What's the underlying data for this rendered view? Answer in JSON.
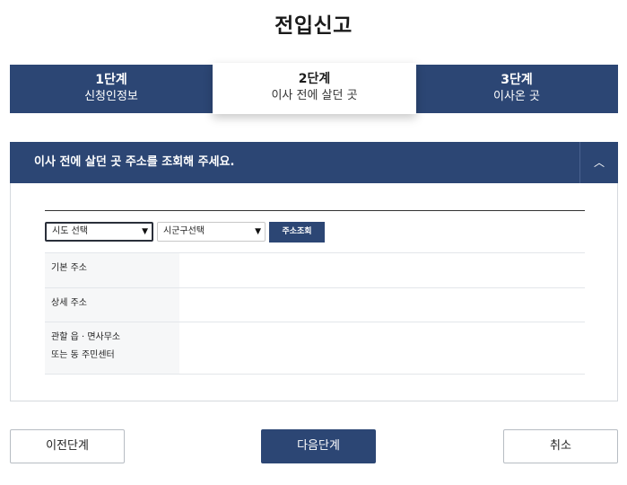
{
  "page": {
    "title": "전입신고"
  },
  "steps": [
    {
      "number": "1단계",
      "name": "신청인정보",
      "active": false
    },
    {
      "number": "2단계",
      "name": "이사 전에 살던 곳",
      "active": true
    },
    {
      "number": "3단계",
      "name": "이사온 곳",
      "active": false
    }
  ],
  "section": {
    "title": "이사 전에 살던 곳 주소를 조회해 주세요.",
    "toggle_icon": "chevron-up-icon",
    "toggle_glyph": "︿",
    "sido_select": {
      "selected": "시도 선택"
    },
    "sigungu_select": {
      "selected": "시군구선택"
    },
    "search_button": "주소조회",
    "rows": [
      {
        "label_lines": [
          "기본 주소"
        ],
        "value": ""
      },
      {
        "label_lines": [
          "상세 주소"
        ],
        "value": ""
      },
      {
        "label_lines": [
          "관할 읍 · 면사무소",
          "또는 동 주민센터"
        ],
        "value": ""
      }
    ]
  },
  "buttons": {
    "prev": "이전단계",
    "next": "다음단계",
    "cancel": "취소"
  },
  "colors": {
    "primary": "#2c4674",
    "border": "#d5d9de",
    "label_bg": "#f6f7f8"
  }
}
